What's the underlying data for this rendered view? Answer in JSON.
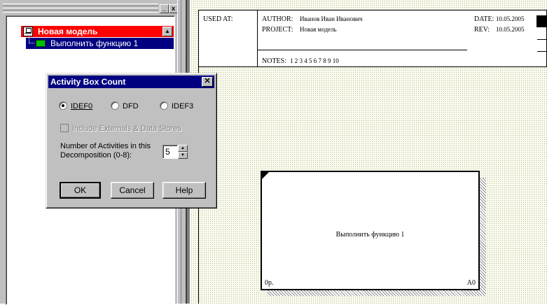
{
  "tree": {
    "root_label": "Новая модель",
    "child_label": "Выполнить функцию 1"
  },
  "panel_buttons": {
    "minimize": "_",
    "close": "x"
  },
  "diagram": {
    "used_at_label": "USED AT:",
    "author_label": "AUTHOR:",
    "author_value": "Иванов Иван Иванович",
    "project_label": "PROJECT:",
    "project_value": "Новая модель",
    "notes_label": "NOTES:",
    "notes_numbers": "1  2  3  4  5  6  7  8  9  10",
    "date_label": "DATE:",
    "date_value": "10.05.2005",
    "rev_label": "REV:",
    "rev_value": "10.05.2005",
    "activity_name": "Выполнить функцию 1",
    "activity_cost": "0р.",
    "activity_number": "A0"
  },
  "dialog": {
    "title": "Activity Box Count",
    "close_glyph": "✕",
    "radio_idef0": "IDEF0",
    "radio_dfd": "DFD",
    "radio_idef3": "IDEF3",
    "selected_method": "IDEF0",
    "checkbox_label": "Include Externals & Data Stores",
    "number_label_line1": "Number of Activities in this",
    "number_label_line2": "Decomposition (0-8):",
    "number_value": "5",
    "ok_label": "OK",
    "cancel_label": "Cancel",
    "help_label": "Help"
  }
}
